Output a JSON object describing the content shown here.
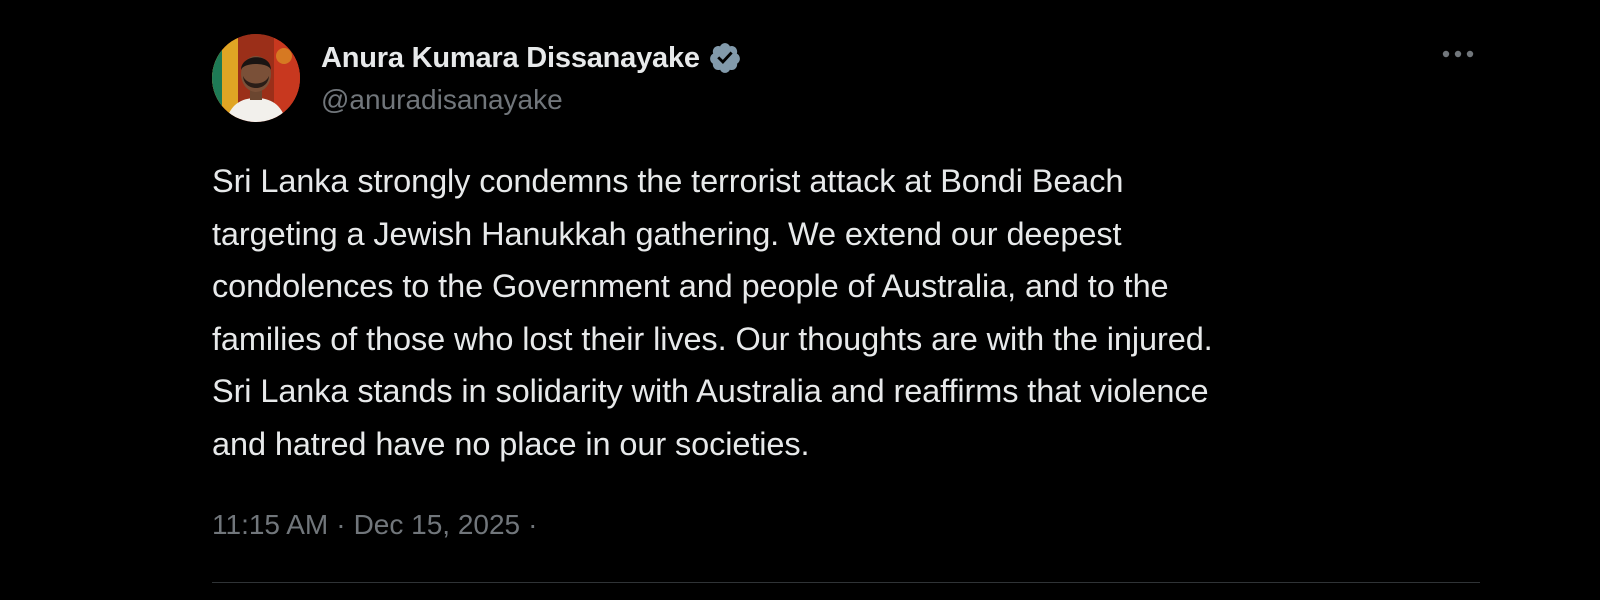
{
  "tweet": {
    "author": {
      "display_name": "Anura Kumara Dissanayake",
      "handle": "@anuradisanayake",
      "verified": true,
      "verified_color": "#829aab"
    },
    "menu_icon": "more-horizontal-icon",
    "text": "Sri Lanka strongly condemns the terrorist attack at Bondi Beach\ntargeting a Jewish Hanukkah gathering. We extend our deepest\ncondolences to the Government and people of Australia, and to the\nfamilies of those who lost their lives. Our thoughts are with the injured.\nSri Lanka stands in solidarity with Australia and reaffirms that violence\nand hatred have no place in our societies.",
    "time": "11:15 AM",
    "separator": "·",
    "date": "Dec 15, 2025",
    "trailing_separator": "·"
  },
  "colors": {
    "background": "#000000",
    "primary_text": "#e7e9ea",
    "secondary_text": "#71767b",
    "divider": "#2f3336"
  }
}
